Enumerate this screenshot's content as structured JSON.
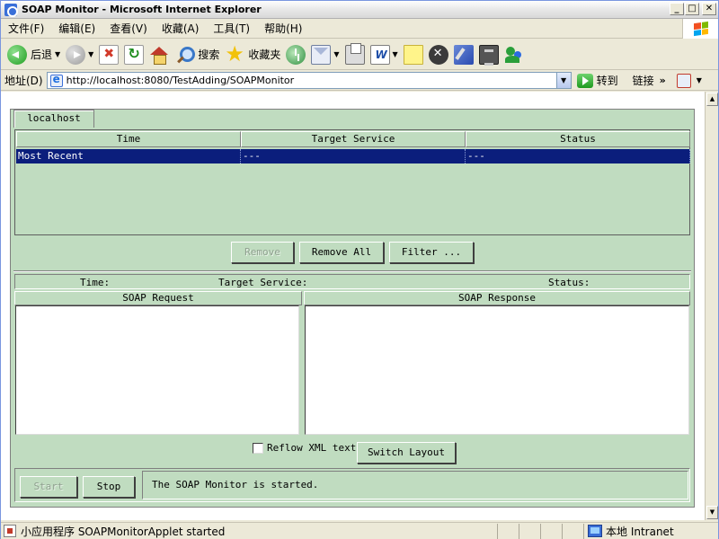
{
  "window": {
    "title": "SOAP Monitor - Microsoft Internet Explorer",
    "controls": [
      "_",
      "□",
      "✕"
    ]
  },
  "menu": [
    "文件(F)",
    "编辑(E)",
    "查看(V)",
    "收藏(A)",
    "工具(T)",
    "帮助(H)"
  ],
  "toolbar": {
    "back_label": "后退",
    "search_label": "搜索",
    "favorites_label": "收藏夹"
  },
  "address": {
    "label": "地址(D)",
    "url": "http://localhost:8080/TestAdding/SOAPMonitor",
    "go_label": "转到",
    "links_label": "链接"
  },
  "applet": {
    "tab_label": "localhost",
    "table": {
      "columns": [
        "Time",
        "Target Service",
        "Status"
      ],
      "rows": [
        [
          "Most Recent",
          "---",
          "---"
        ]
      ]
    },
    "buttons": {
      "remove": "Remove",
      "remove_all": "Remove All",
      "filter": "Filter ..."
    },
    "info": {
      "time_label": "Time:",
      "target_label": "Target Service:",
      "status_label": "Status:"
    },
    "panes": {
      "request_title": "SOAP Request",
      "response_title": "SOAP Response"
    },
    "reflow_label": "Reflow XML text",
    "reflow_checked": false,
    "switch_layout": "Switch Layout",
    "start": "Start",
    "stop": "Stop",
    "status_message": "The SOAP Monitor is started."
  },
  "statusbar": {
    "message": "小应用程序 SOAPMonitorApplet started",
    "zone": "本地 Intranet"
  }
}
